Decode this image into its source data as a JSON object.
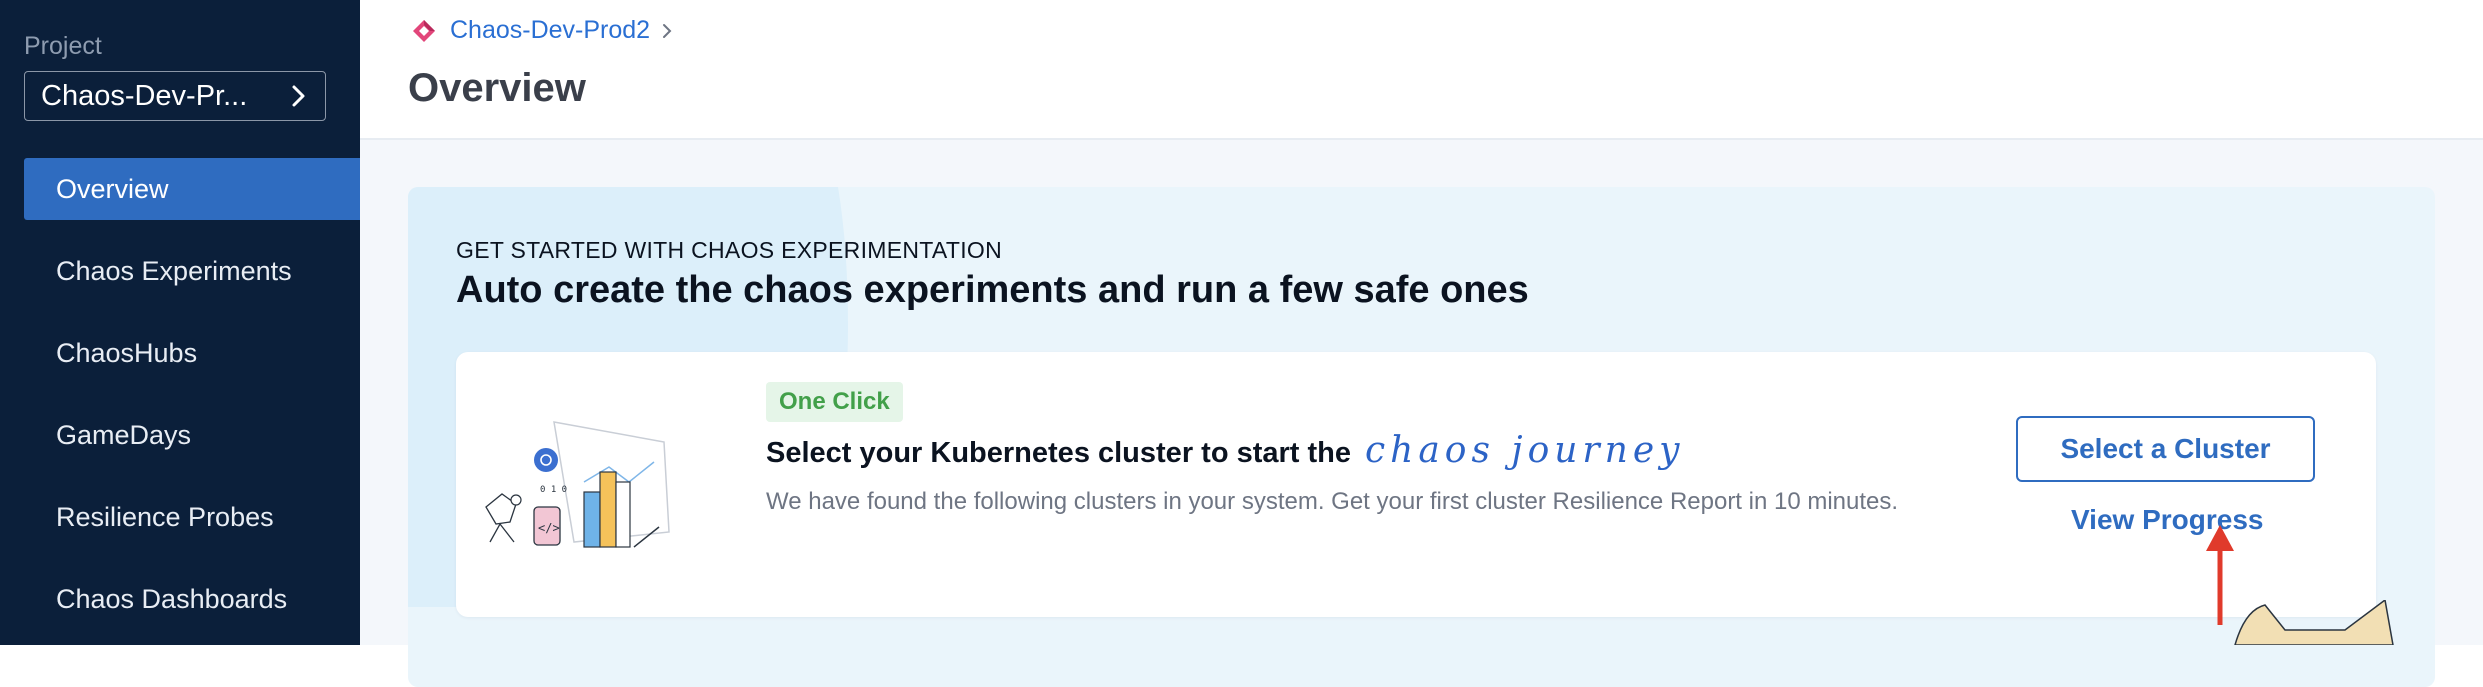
{
  "sidebar": {
    "project_label": "Project",
    "project_name": "Chaos-Dev-Pr...",
    "items": [
      {
        "label": "Overview",
        "active": true
      },
      {
        "label": "Chaos Experiments"
      },
      {
        "label": "ChaosHubs"
      },
      {
        "label": "GameDays"
      },
      {
        "label": "Resilience Probes"
      },
      {
        "label": "Chaos Dashboards"
      }
    ]
  },
  "header": {
    "breadcrumb": "Chaos-Dev-Prod2",
    "title": "Overview"
  },
  "banner": {
    "eyebrow": "GET STARTED WITH CHAOS EXPERIMENTATION",
    "headline": "Auto create the chaos experiments and run a few safe ones"
  },
  "card": {
    "badge": "One Click",
    "title": "Select your Kubernetes cluster to start the",
    "title_script": "chaos journey",
    "description": "We have found the following clusters in your system. Get your first cluster Resilience Report in 10 minutes.",
    "select_button": "Select a Cluster",
    "progress_link": "View Progress"
  },
  "icons": {
    "project_chevron": "chevron-right-icon",
    "breadcrumb_logo": "chaos-module-icon",
    "breadcrumb_separator": "chevron-right-icon",
    "annotation_arrow": "red-arrow-up-icon"
  },
  "colors": {
    "sidebar_bg": "#0b1f3a",
    "active_nav": "#2f6cc0",
    "accent": "#2f6cc0",
    "badge_green": "#42a04a",
    "annotation_red": "#e03a2b"
  }
}
